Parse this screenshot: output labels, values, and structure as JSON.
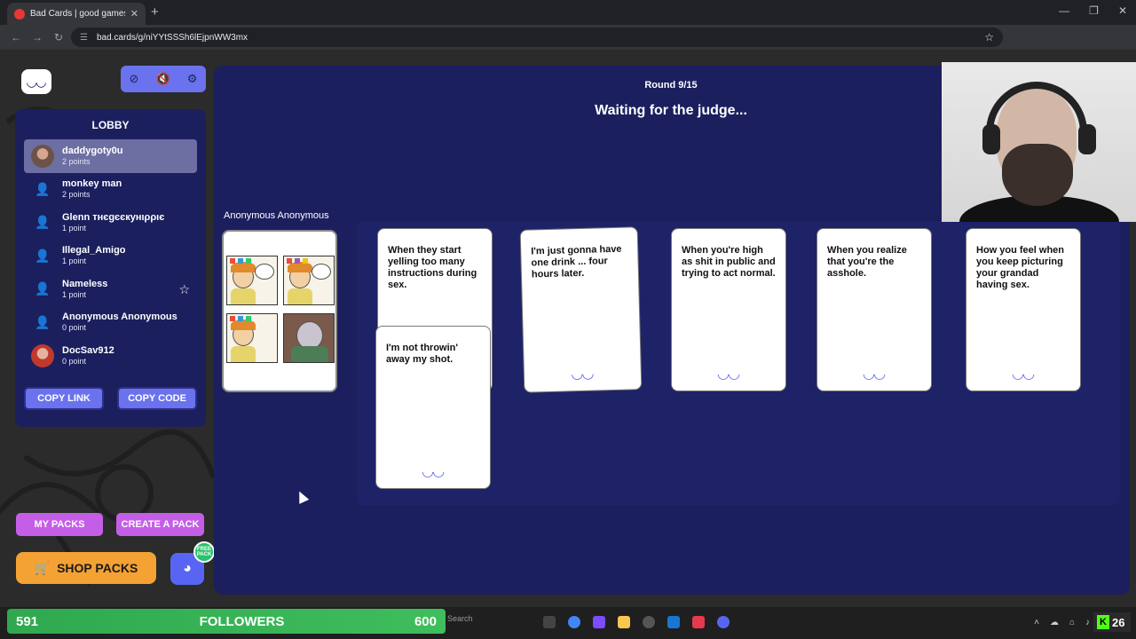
{
  "browser": {
    "tab_title": "Bad Cards | good games for yo",
    "tab_close": "✕",
    "new_tab": "+",
    "url": "bad.cards/g/niYYtSSSh6lEjpnWW3mx"
  },
  "toolbar": {
    "mute_icon": "⊘",
    "sound_icon": "🔇",
    "settings_icon": "⚙"
  },
  "lobby": {
    "title": "LOBBY",
    "players": [
      {
        "name": "daddygoty0u",
        "points": "2 points"
      },
      {
        "name": "monkey man",
        "points": "2 points"
      },
      {
        "name": "Glenn тнєgєєкунιρριє",
        "points": "1 point"
      },
      {
        "name": "Illegal_Amigo",
        "points": "1 point"
      },
      {
        "name": "Nameless",
        "points": "1 point"
      },
      {
        "name": "Anonymous Anonymous",
        "points": "0 point"
      },
      {
        "name": "DocSav912",
        "points": "0 point"
      }
    ],
    "copy_link": "COPY LINK",
    "copy_code": "COPY CODE"
  },
  "packs": {
    "my_packs": "MY PACKS",
    "create_pack": "CREATE A PACK",
    "shop_packs": "SHOP PACKS",
    "free_pack": "FREE PACK"
  },
  "game": {
    "round": "Round 9/15",
    "status": "Waiting for the judge...",
    "judge": "Anonymous Anonymous",
    "cards": [
      "When they start yelling too many instructions during sex.",
      "I'm not throwin' away my shot.",
      "I'm just gonna have one drink ... four hours later.",
      "When you're high as shit in public and trying to act normal.",
      "When you realize that you're the asshole.",
      "How you feel when you keep picturing your grandad having sex."
    ]
  },
  "taskbar": {
    "followers_current": "591",
    "followers_label": "FOLLOWERS",
    "followers_goal": "600",
    "search": "Search",
    "tray_count": "26"
  },
  "colors": {
    "board": "#1b1f5e",
    "accent": "#6b72ee",
    "pack_button": "#c55ee6",
    "shop_button": "#f4a233"
  }
}
